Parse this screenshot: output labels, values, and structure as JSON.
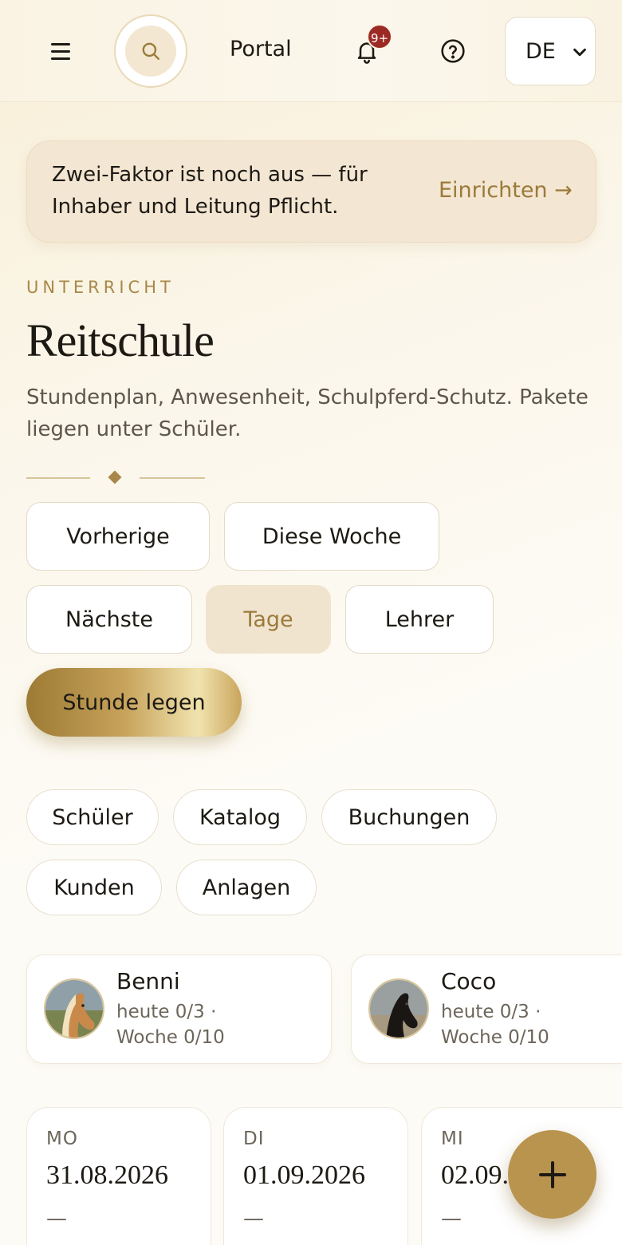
{
  "header": {
    "menu_icon": "hamburger-menu-icon",
    "search_icon": "search-icon",
    "portal_label": "Portal",
    "notifications_icon": "bell-icon",
    "notifications_badge": "9+",
    "help_icon": "question-circle-icon",
    "language": {
      "selected": "DE",
      "options": [
        "DE"
      ]
    }
  },
  "banner": {
    "text": "Zwei-Faktor ist noch aus — für Inhaber und Leitung Pflicht.",
    "action": "Einrichten →"
  },
  "page": {
    "eyebrow": "UNTERRICHT",
    "title": "Reitschule",
    "subtitle": "Stundenplan, Anwesenheit, Schulpferd-Schutz. Pakete liegen unter Schüler."
  },
  "toolbar": {
    "previous": "Vorherige",
    "this_week": "Diese Woche",
    "next": "Nächste",
    "days": "Tage",
    "teacher": "Lehrer",
    "add_lesson": "Stunde legen",
    "active_view": "Tage"
  },
  "nav_chips": [
    "Schüler",
    "Katalog",
    "Buchungen",
    "Kunden",
    "Anlagen"
  ],
  "horses": [
    {
      "name": "Benni",
      "line1": "heute 0/3 ·",
      "line2": "Woche 0/10"
    },
    {
      "name": "Coco",
      "line1": "heute 0/3 ·",
      "line2": "Woche 0/10"
    }
  ],
  "days": [
    {
      "name": "MO",
      "date": "31.08.2026",
      "empty": "—"
    },
    {
      "name": "DI",
      "date": "01.09.2026",
      "empty": "—"
    },
    {
      "name": "MI",
      "date": "02.09.2026",
      "empty": "—"
    }
  ],
  "fab_icon": "plus-icon",
  "colors": {
    "accent": "#a88848",
    "accent_text": "#9b7a3a",
    "badge": "#9c2a24",
    "fab": "#b8944e"
  }
}
